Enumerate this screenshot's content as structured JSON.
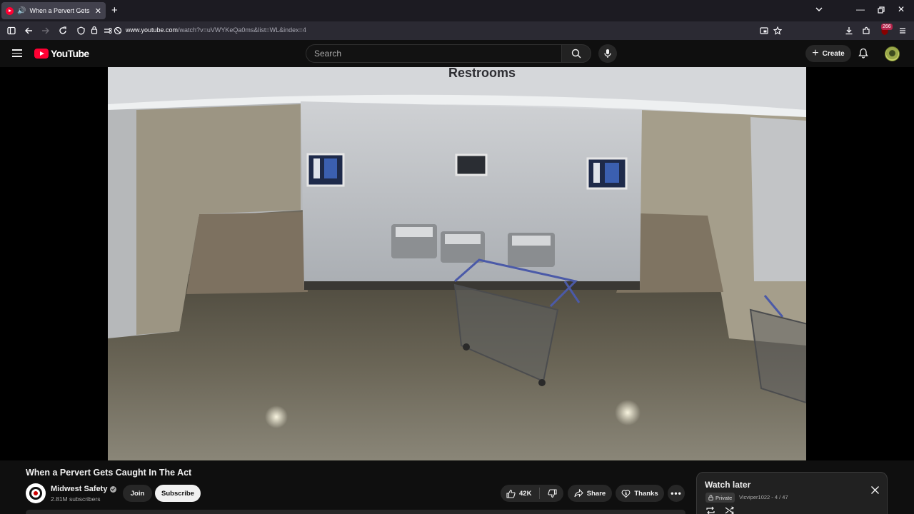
{
  "browser": {
    "tab_title": "When a Pervert Gets Caught In The Act",
    "url_host": "www.youtube.com",
    "url_path": "/watch?v=uVWYKeQa0ms&list=WL&index=4",
    "extensions_badge": "266"
  },
  "masthead": {
    "logo_text": "YouTube",
    "search_placeholder": "Search",
    "create_label": "Create"
  },
  "video": {
    "scene_sign_text": "Restrooms",
    "title": "When a Pervert Gets Caught In The Act"
  },
  "channel": {
    "name": "Midwest Safety",
    "subscribers": "2.81M subscribers",
    "join_label": "Join",
    "subscribe_label": "Subscribe"
  },
  "actions": {
    "likes": "42K",
    "share_label": "Share",
    "thanks_label": "Thanks"
  },
  "playlist": {
    "title": "Watch later",
    "privacy": "Private",
    "meta": "Vicviper1022 - 4 / 47"
  },
  "colors": {
    "brand_red": "#ff0033",
    "page_bg": "#0f0f0f",
    "browser_tab_bg": "#42414d"
  }
}
